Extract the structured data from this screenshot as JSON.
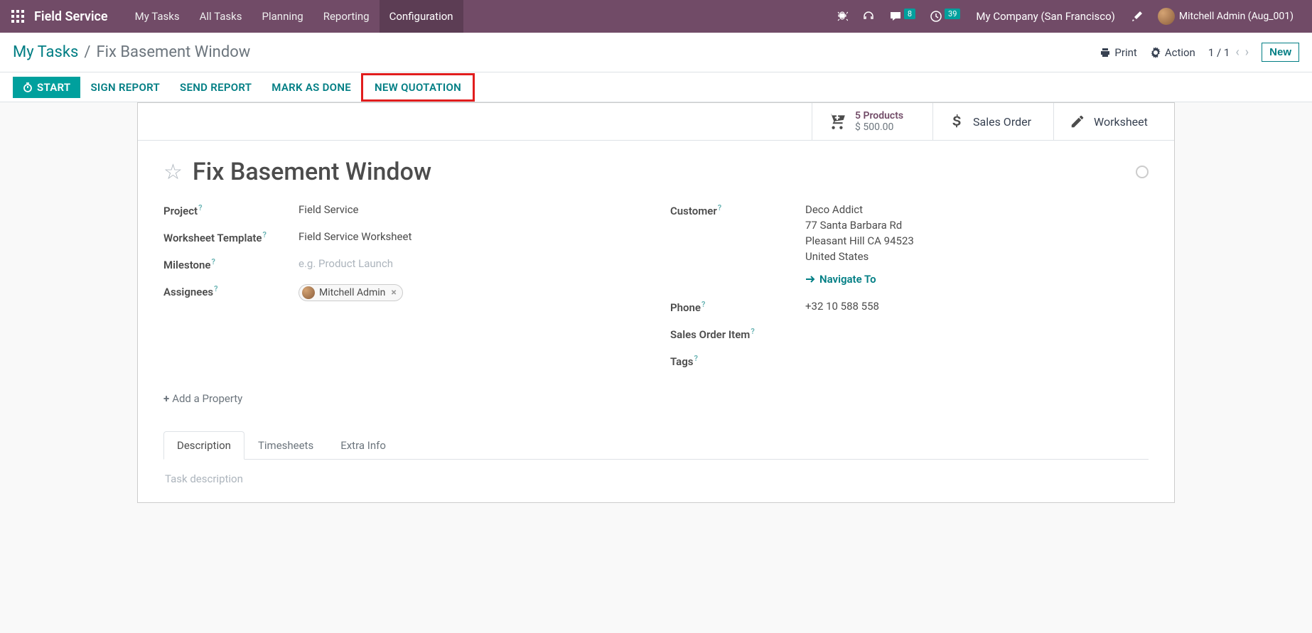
{
  "navbar": {
    "brand": "Field Service",
    "menu": [
      "My Tasks",
      "All Tasks",
      "Planning",
      "Reporting",
      "Configuration"
    ],
    "active_menu_index": 4,
    "messages_badge": "8",
    "activities_badge": "39",
    "company": "My Company (San Francisco)",
    "user": "Mitchell Admin (Aug_001)"
  },
  "breadcrumb": {
    "root": "My Tasks",
    "current": "Fix Basement Window"
  },
  "controls": {
    "print": "Print",
    "action": "Action",
    "pager": "1 / 1",
    "new": "New"
  },
  "statusbar": {
    "start": "START",
    "sign_report": "SIGN REPORT",
    "send_report": "SEND REPORT",
    "mark_done": "MARK AS DONE",
    "new_quotation": "NEW QUOTATION"
  },
  "stat_buttons": {
    "products": {
      "line1": "5 Products",
      "line2": "$ 500.00"
    },
    "sales_order": "Sales Order",
    "worksheet": "Worksheet"
  },
  "task": {
    "title": "Fix Basement Window",
    "fields_left": {
      "project_label": "Project",
      "project_value": "Field Service",
      "worksheet_template_label": "Worksheet Template",
      "worksheet_template_value": "Field Service Worksheet",
      "milestone_label": "Milestone",
      "milestone_placeholder": "e.g. Product Launch",
      "assignees_label": "Assignees",
      "assignee_name": "Mitchell Admin"
    },
    "fields_right": {
      "customer_label": "Customer",
      "customer_name": "Deco Addict",
      "customer_addr1": "77 Santa Barbara Rd",
      "customer_addr2": "Pleasant Hill CA 94523",
      "customer_country": "United States",
      "navigate_to": "Navigate To",
      "phone_label": "Phone",
      "phone_value": "+32 10 588 558",
      "soi_label": "Sales Order Item",
      "tags_label": "Tags"
    },
    "add_property": "Add a Property",
    "tabs": [
      "Description",
      "Timesheets",
      "Extra Info"
    ],
    "active_tab_index": 0,
    "desc_placeholder": "Task description"
  }
}
